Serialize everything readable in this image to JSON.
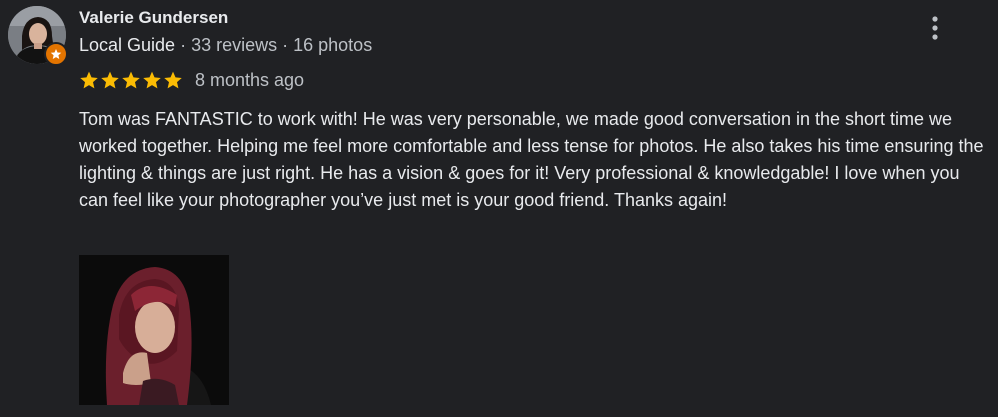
{
  "reviewer": {
    "name": "Valerie Gundersen",
    "badge": "Local Guide",
    "separator1": " · ",
    "reviews": "33 reviews",
    "separator2": " · ",
    "photos": "16 photos"
  },
  "review": {
    "rating": 5,
    "rating_max": 5,
    "time": "8 months ago",
    "text": "Tom was FANTASTIC to work with! He was very personable, we made good conversation in the short time we worked together. Helping me feel more comfortable and less tense for photos. He also takes his time ensuring the lighting & things are just right. He has a vision & goes for it! Very professional & knowledgable! I love when you can feel like your photographer you’ve just met is your good friend. Thanks again!"
  },
  "icons": {
    "star": "star-icon",
    "menu": "more-vert-icon",
    "badge": "local-guide-star-icon"
  },
  "colors": {
    "background": "#202124",
    "text_primary": "#e8eaed",
    "text_secondary": "#bdc1c6",
    "star": "#fbbc04",
    "badge": "#e37400"
  }
}
